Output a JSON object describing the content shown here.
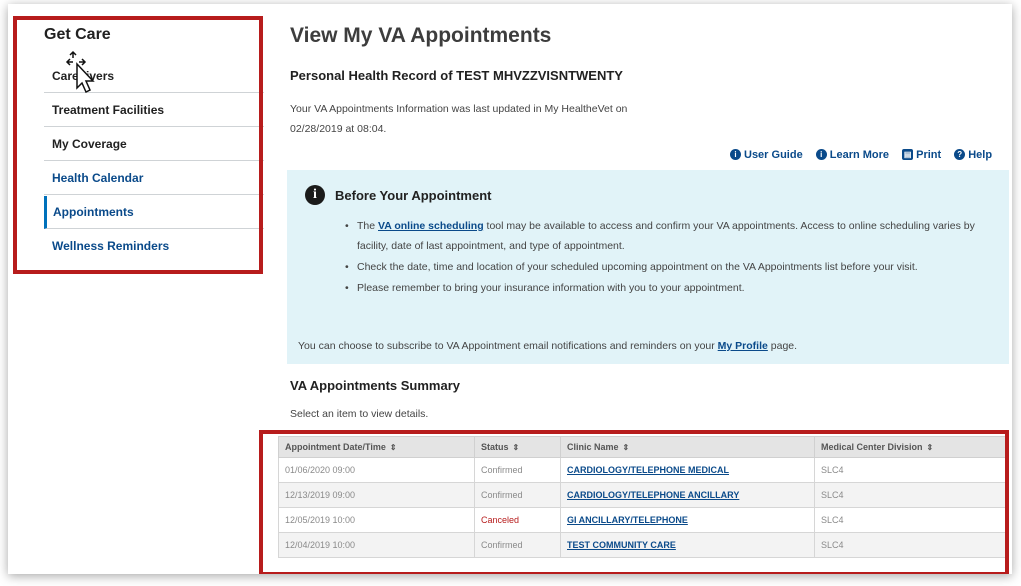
{
  "sidebar": {
    "title": "Get Care",
    "items": [
      {
        "label": "Caregivers"
      },
      {
        "label": "Treatment Facilities"
      },
      {
        "label": "My Coverage"
      },
      {
        "label": "Health Calendar"
      },
      {
        "label": "Appointments"
      },
      {
        "label": "Wellness Reminders"
      }
    ]
  },
  "main": {
    "title": "View My VA Appointments",
    "subtitle": "Personal Health Record of TEST MHVZZVISNTWENTY",
    "updated_line1": "Your VA Appointments Information was last updated in My HealtheVet on",
    "updated_line2": "02/28/2019 at 08:04.",
    "tools": [
      {
        "label": "User Guide",
        "icon": "info-circle-icon"
      },
      {
        "label": "Learn More",
        "icon": "info-circle-icon"
      },
      {
        "label": "Print",
        "icon": "printer-icon"
      },
      {
        "label": "Help",
        "icon": "question-circle-icon"
      }
    ]
  },
  "info_box": {
    "title": "Before Your Appointment",
    "bullet1_pre": "The ",
    "bullet1_link": "VA online scheduling",
    "bullet1_post": " tool may be available to access and confirm your VA appointments. Access to online scheduling varies by facility, date of last appointment, and type of appointment.",
    "bullet2": "Check the date, time and location of your scheduled upcoming appointment on the VA Appointments list before your visit.",
    "bullet3": "Please remember to bring your insurance information with you to your appointment.",
    "subscribe_pre": "You can choose to subscribe to VA Appointment email notifications and reminders on your ",
    "subscribe_link": "My Profile",
    "subscribe_post": " page."
  },
  "summary": {
    "title": "VA Appointments Summary",
    "hint": "Select an item to view details.",
    "columns": [
      "Appointment Date/Time",
      "Status",
      "Clinic Name",
      "Medical Center Division"
    ],
    "rows": [
      {
        "date": "01/06/2020 09:00",
        "status": "Confirmed",
        "clinic": "CARDIOLOGY/TELEPHONE MEDICAL",
        "division": "SLC4"
      },
      {
        "date": "12/13/2019 09:00",
        "status": "Confirmed",
        "clinic": "CARDIOLOGY/TELEPHONE ANCILLARY",
        "division": "SLC4"
      },
      {
        "date": "12/05/2019 10:00",
        "status": "Canceled",
        "clinic": "GI ANCILLARY/TELEPHONE",
        "division": "SLC4"
      },
      {
        "date": "12/04/2019 10:00",
        "status": "Confirmed",
        "clinic": "TEST COMMUNITY CARE",
        "division": "SLC4"
      }
    ]
  },
  "colors": {
    "highlight": "#b71c1c",
    "link": "#0a4a8a",
    "info_bg": "#e1f3f8"
  }
}
